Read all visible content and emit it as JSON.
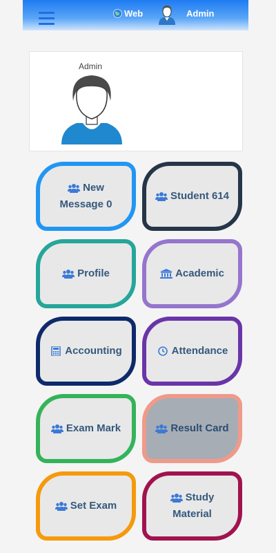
{
  "topbar": {
    "web_label": "Web",
    "user_label": "Admin",
    "gradient_top": "#1e7bf2"
  },
  "profile": {
    "name": "Admin"
  },
  "tiles": [
    {
      "id": "new-message",
      "line1": "New",
      "line2": "Message 0",
      "icon": "users-icon",
      "border": "#2196f3",
      "bg": "#e8e8e8"
    },
    {
      "id": "student",
      "line1": "Student 614",
      "line2": "",
      "icon": "users-icon",
      "border": "#263548",
      "bg": "#e8e8e8"
    },
    {
      "id": "profile",
      "line1": "Profile",
      "line2": "",
      "icon": "users-icon",
      "border": "#26a69a",
      "bg": "#e8e8e8"
    },
    {
      "id": "academic",
      "line1": "Academic",
      "line2": "",
      "icon": "institution-icon",
      "border": "#9575cd",
      "bg": "#e8e8e8"
    },
    {
      "id": "accounting",
      "line1": "Accounting",
      "line2": "",
      "icon": "calculator-icon",
      "border": "#0d2a6b",
      "bg": "#e8e8e8"
    },
    {
      "id": "attendance",
      "line1": "Attendance",
      "line2": "",
      "icon": "clock-icon",
      "border": "#6a35a8",
      "bg": "#e8e8e8"
    },
    {
      "id": "exam-mark",
      "line1": "Exam Mark",
      "line2": "",
      "icon": "users-icon",
      "border": "#34b35a",
      "bg": "#e8e8e8"
    },
    {
      "id": "result-card",
      "line1": "Result Card",
      "line2": "",
      "icon": "users-icon",
      "border": "#ef9a8a",
      "bg": "#a6adb4"
    },
    {
      "id": "set-exam",
      "line1": "Set Exam",
      "line2": "",
      "icon": "users-icon",
      "border": "#f59a0c",
      "bg": "#e8e8e8"
    },
    {
      "id": "study-material",
      "line1": "Study",
      "line2": "Material",
      "icon": "users-icon",
      "border": "#a0134f",
      "bg": "#e8e8e8"
    }
  ]
}
